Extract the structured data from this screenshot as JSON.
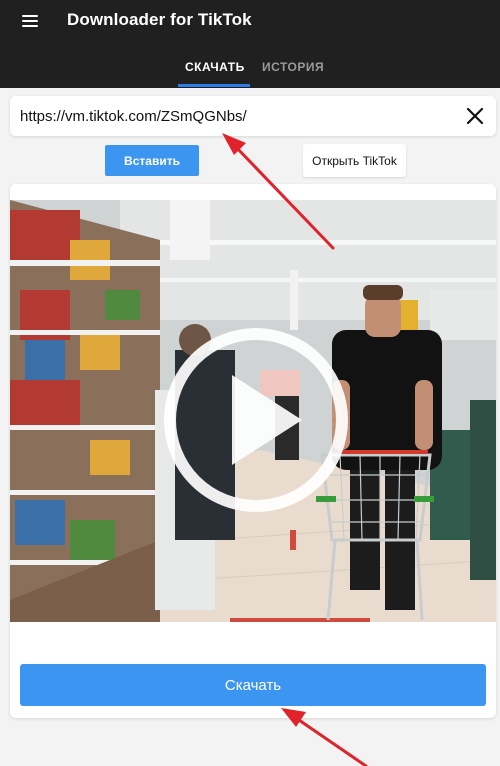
{
  "app": {
    "title": "Downloader for TikTok",
    "menu_icon": "hamburger-menu-icon",
    "tabs": [
      {
        "label": "СКАЧАТЬ",
        "active": true
      },
      {
        "label": "ИСТОРИЯ",
        "active": false
      }
    ]
  },
  "url_field": {
    "value": "https://vm.tiktok.com/ZSmQGNbs/",
    "clear_icon": "close-icon"
  },
  "actions": {
    "paste_label": "Вставить",
    "open_tiktok_label": "Открыть TikTok"
  },
  "video": {
    "thumbnail_icon": "play-icon",
    "download_label": "Скачать"
  },
  "colors": {
    "appbar": "#202020",
    "accent": "#3d95f2",
    "tab_indicator": "#2b7de9",
    "annotation_arrow": "#e0232b"
  }
}
